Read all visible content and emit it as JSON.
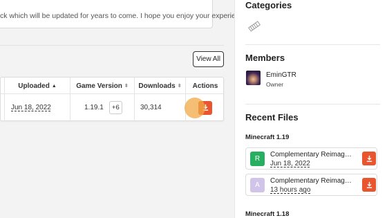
{
  "description": {
    "text": "ck which will be updated for years to come. I hope you enjoy your experience!"
  },
  "files_section": {
    "view_all_label": "View All",
    "columns": [
      {
        "label": "Uploaded",
        "sort": "▲"
      },
      {
        "label": "Game Version",
        "sort": "⬍"
      },
      {
        "label": "Downloads",
        "sort": "⬍"
      },
      {
        "label": "Actions",
        "sort": ""
      }
    ],
    "rows": [
      {
        "uploaded": "Jun 18, 2022",
        "game_version": "1.19.1",
        "more_versions": "+6",
        "downloads": "30,314"
      }
    ]
  },
  "sidebar": {
    "categories_title": "Categories",
    "members_title": "Members",
    "members": [
      {
        "name": "EminGTR",
        "role": "Owner"
      }
    ],
    "recent_files_title": "Recent Files",
    "groups": [
      {
        "version": "Minecraft 1.19",
        "files": [
          {
            "badge": "R",
            "badge_color": "#27ae60",
            "name": "Complementary Reimagined",
            "date": "Jun 18, 2022"
          },
          {
            "badge": "A",
            "badge_color": "#d1c4e9",
            "name": "Complementary Reimagined",
            "date": "13 hours ago"
          }
        ]
      },
      {
        "version": "Minecraft 1.18",
        "files": []
      }
    ]
  },
  "colors": {
    "accent": "#e8552e",
    "release_badge": "#27ae60",
    "alpha_badge": "#d1c4e9"
  }
}
